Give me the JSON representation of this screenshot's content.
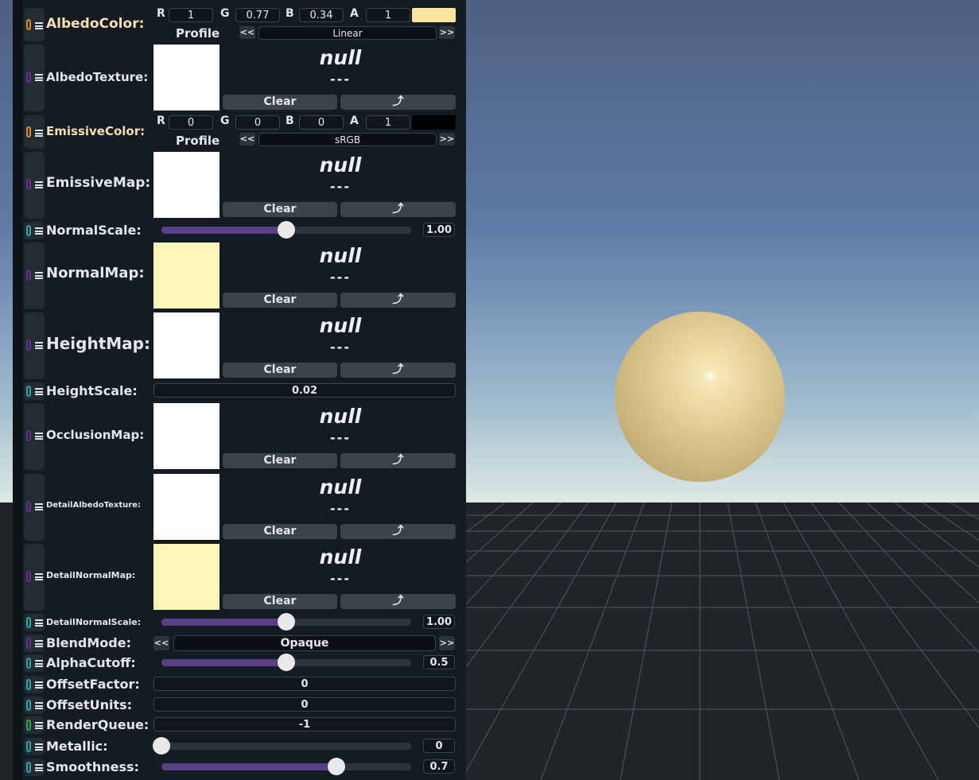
{
  "colors": {
    "orange": "#e88a1a",
    "purple": "#6a2d94",
    "cyan": "#28a8a0",
    "green": "#2ca84a",
    "sphere": "#e2cb8f",
    "sky_top": "#4f6282",
    "sky_bottom": "#dbe7e2",
    "floor": "#1f2227"
  },
  "common": {
    "null": "null",
    "dash": "---",
    "clear": "Clear",
    "profile": "Profile",
    "prev": "<<",
    "next": ">>",
    "r": "R",
    "g": "G",
    "b": "B",
    "a": "A"
  },
  "albedo_color": {
    "label": "AlbedoColor:",
    "r": "1",
    "g": "0.77",
    "b": "0.34",
    "a": "1",
    "swatch": "#fde5a0",
    "profile": "Linear"
  },
  "albedo_texture": {
    "label": "AlbedoTexture:"
  },
  "emissive_color": {
    "label": "EmissiveColor:",
    "r": "0",
    "g": "0",
    "b": "0",
    "a": "1",
    "swatch": "#000000",
    "profile": "sRGB"
  },
  "emissive_map": {
    "label": "EmissiveMap:"
  },
  "normal_scale": {
    "label": "NormalScale:",
    "value": "1.00",
    "level": 0.5
  },
  "normal_map": {
    "label": "NormalMap:"
  },
  "height_map": {
    "label": "HeightMap:"
  },
  "height_scale": {
    "label": "HeightScale:",
    "value": "0.02"
  },
  "occlusion_map": {
    "label": "OcclusionMap:"
  },
  "detail_albedo": {
    "label": "DetailAlbedoTexture:"
  },
  "detail_normal_map": {
    "label": "DetailNormalMap:"
  },
  "detail_normal_scale": {
    "label": "DetailNormalScale:",
    "value": "1.00",
    "level": 0.5
  },
  "blend_mode": {
    "label": "BlendMode:",
    "value": "Opaque"
  },
  "alpha_cutoff": {
    "label": "AlphaCutoff:",
    "value": "0.5",
    "level": 0.5
  },
  "offset_factor": {
    "label": "OffsetFactor:",
    "value": "0"
  },
  "offset_units": {
    "label": "OffsetUnits:",
    "value": "0"
  },
  "render_queue": {
    "label": "RenderQueue:",
    "value": "-1"
  },
  "metallic": {
    "label": "Metallic:",
    "value": "0",
    "level": 0
  },
  "smoothness": {
    "label": "Smoothness:",
    "value": "0.7",
    "level": 0.7
  }
}
